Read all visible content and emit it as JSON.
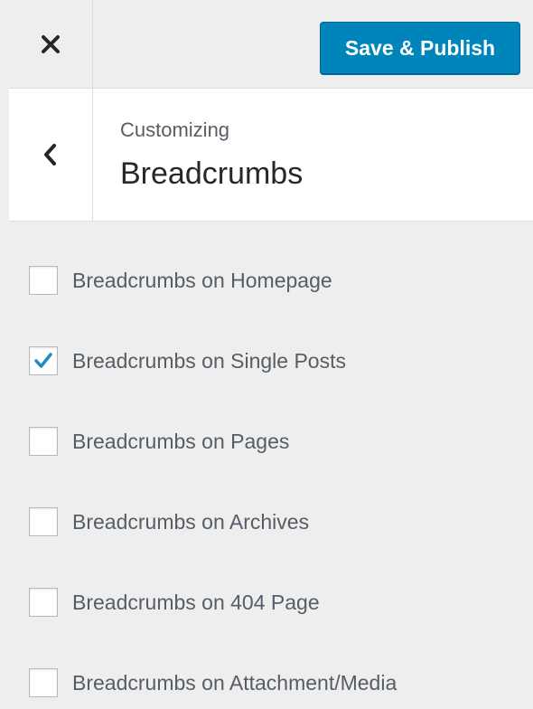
{
  "header": {
    "close_icon": "close-icon",
    "publish_label": "Save & Publish",
    "accent_color": "#0085ba"
  },
  "section": {
    "back_icon": "chevron-left-icon",
    "subtitle": "Customizing",
    "title": "Breadcrumbs"
  },
  "options": [
    {
      "label": "Breadcrumbs on Homepage",
      "checked": false
    },
    {
      "label": "Breadcrumbs on Single Posts",
      "checked": true
    },
    {
      "label": "Breadcrumbs on Pages",
      "checked": false
    },
    {
      "label": "Breadcrumbs on Archives",
      "checked": false
    },
    {
      "label": "Breadcrumbs on 404 Page",
      "checked": false
    },
    {
      "label": "Breadcrumbs on Attachment/Media",
      "checked": false
    }
  ],
  "checkmark_color": "#1e8cbe"
}
